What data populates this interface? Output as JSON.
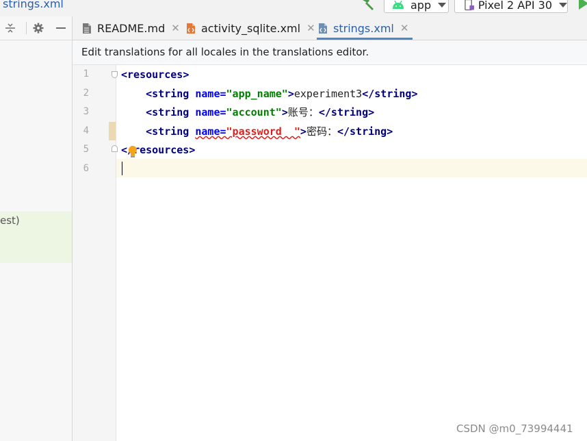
{
  "nav": {
    "breadcrumb": "strings.xml",
    "run_config": "app",
    "device": "Pixel 2 API 30"
  },
  "left_panel": {
    "partial_item": "est)"
  },
  "tabs": [
    {
      "label": "README.md",
      "icon": "markdown-file-icon",
      "active": false
    },
    {
      "label": "activity_sqlite.xml",
      "icon": "layout-xml-icon",
      "active": false
    },
    {
      "label": "strings.xml",
      "icon": "values-xml-icon",
      "active": true
    }
  ],
  "banner": {
    "text": "Edit translations for all locales in the translations editor."
  },
  "editor": {
    "line_numbers": [
      "1",
      "2",
      "3",
      "4",
      "5",
      "6"
    ],
    "line1": {
      "open": "<",
      "tag": "resources",
      "close": ">"
    },
    "line2": {
      "indent": "    ",
      "lt": "<",
      "tag": "string",
      "attr": "name",
      "eq": "=",
      "value": "\"app_name\"",
      "gt": ">",
      "text": "experiment3",
      "end_lt": "</",
      "end_tag": "string",
      "end_gt": ">"
    },
    "line3": {
      "indent": "    ",
      "lt": "<",
      "tag": "string",
      "attr": "name",
      "eq": "=",
      "value": "\"account\"",
      "gt": ">",
      "text": "账号：",
      "end_lt": "</",
      "end_tag": "string",
      "end_gt": ">"
    },
    "line4": {
      "indent": "    ",
      "lt": "<",
      "tag": "string",
      "attr": "name",
      "eq": "=",
      "value": "\"password  \"",
      "gt": ">",
      "text": "密码：",
      "end_lt": "</",
      "end_tag": "string",
      "end_gt": ">"
    },
    "line5": {
      "open": "</",
      "tag": "resources",
      "close": ">"
    }
  },
  "watermark": "CSDN @m0_73994441",
  "colors": {
    "tag": "#000080",
    "attribute": "#0000ff",
    "value": "#008000",
    "error": "#e01d1d",
    "active_tab": "#2b5fa8",
    "caret_line": "#fdf9e9"
  }
}
